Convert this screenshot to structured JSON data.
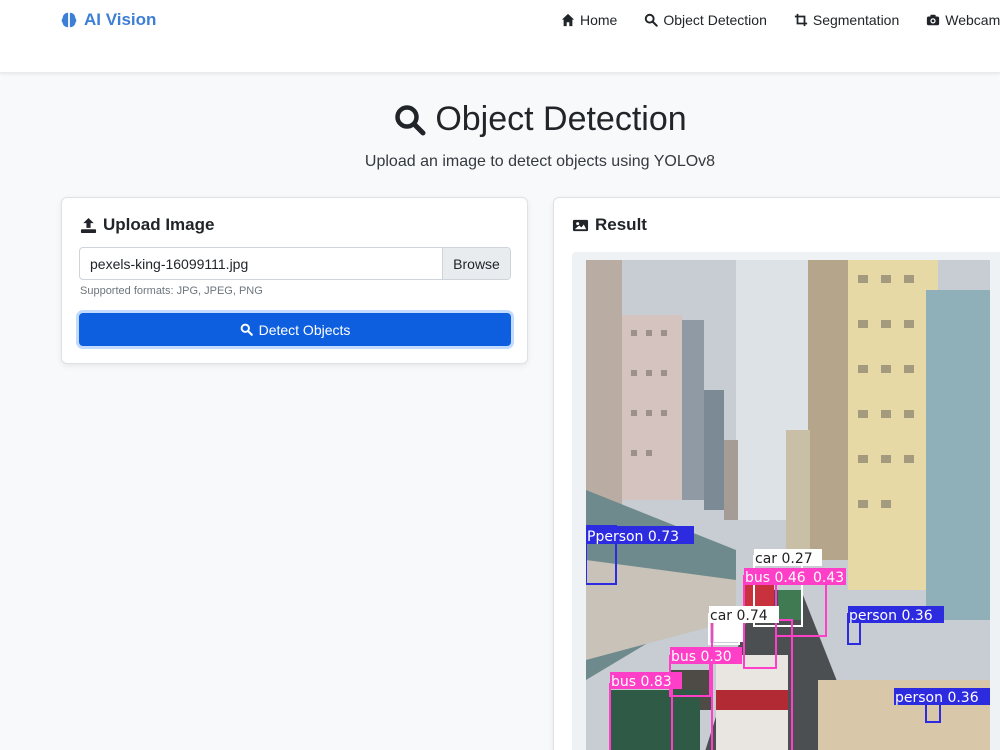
{
  "brand": {
    "name": "AI Vision",
    "color": "#3d7fd6"
  },
  "nav": [
    {
      "label": "Home",
      "icon": "home-icon"
    },
    {
      "label": "Object Detection",
      "icon": "search-icon"
    },
    {
      "label": "Segmentation",
      "icon": "crop-icon"
    },
    {
      "label": "Webcam",
      "icon": "camera-icon"
    }
  ],
  "header": {
    "title": "Object Detection",
    "subtitle": "Upload an image to detect objects using YOLOv8"
  },
  "upload": {
    "title": "Upload Image",
    "file_name": "pexels-king-16099111.jpg",
    "browse_label": "Browse",
    "help_text": "Supported formats: JPG, JPEG, PNG",
    "detect_label": "Detect Objects",
    "accent": "#0d5fe0"
  },
  "result": {
    "title": "Result",
    "detections": [
      {
        "label": "Pperson 0.73"
      },
      {
        "label": "car 0.27"
      },
      {
        "label": "bus 0.46"
      },
      {
        "label": "0.43"
      },
      {
        "label": "car 0.74"
      },
      {
        "label": "person 0.36"
      },
      {
        "label": "bus 0.30"
      },
      {
        "label": "bus 0.83"
      },
      {
        "label": "person 0.36"
      }
    ]
  }
}
